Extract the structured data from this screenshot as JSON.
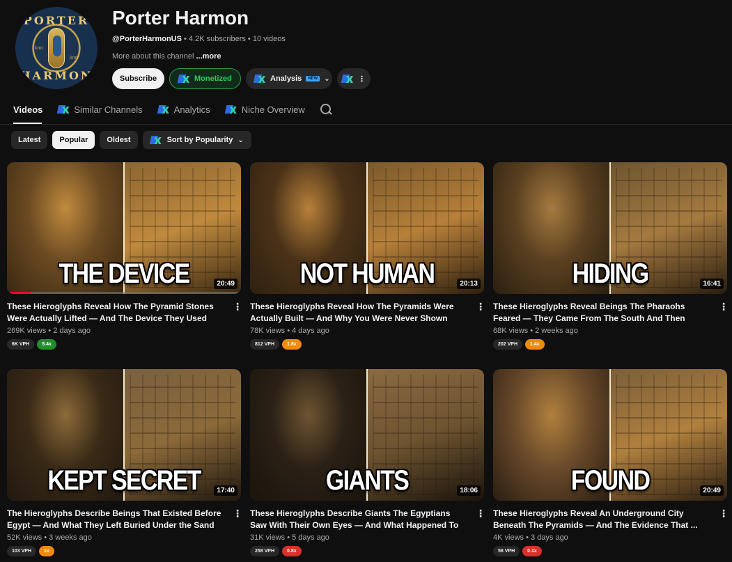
{
  "channel": {
    "name": "Porter Harmon",
    "handle": "@PorterHarmonUS",
    "meta_rest": " • 4.2K subscribers • 10 videos",
    "about": "More about this channel ",
    "about_more": "...more",
    "avatar_top": "PORTER",
    "avatar_bottom": "HARMON",
    "avatar_side_left": "kmt",
    "avatar_side_right": "kmt"
  },
  "buttons": {
    "subscribe": "Subscribe",
    "monetized": "Monetized",
    "analysis": "Analysis",
    "analysis_badge": "NEW",
    "more_dots": "⋮"
  },
  "tabs": [
    {
      "label": "Videos"
    },
    {
      "label": "Similar Channels"
    },
    {
      "label": "Analytics"
    },
    {
      "label": "Niche Overview"
    }
  ],
  "chips": {
    "latest": "Latest",
    "popular": "Popular",
    "oldest": "Oldest",
    "sort": "Sort by Popularity"
  },
  "colors": {
    "background": "#0f0f0f",
    "accent_green": "#2ecc5a",
    "badge_orange": "#f08a0c",
    "badge_red": "#d6312b"
  },
  "videos": [
    {
      "overlay": "THE DEVICE",
      "duration": "20:49",
      "title": "These Hieroglyphs Reveal How The Pyramid Stones Were Actually Lifted —  And The Device They Used",
      "stats": "269K views • 2 days ago",
      "vph": "6K VPH",
      "ratio": "5.4x",
      "ratio_color": "green",
      "watched": 0.1
    },
    {
      "overlay": "NOT HUMAN",
      "duration": "20:13",
      "title": "These Hieroglyphs Reveal How The Pyramids Were Actually Built — And Why You Were Never Shown Them",
      "stats": "78K views • 4 days ago",
      "vph": "812 VPH",
      "ratio": "1.8x",
      "ratio_color": "orange",
      "watched": 0
    },
    {
      "overlay": "HIDING",
      "duration": "16:41",
      "title": "These Hieroglyphs Reveal Beings The Pharaohs Feared — They Came From The South And Then Vanished",
      "stats": "68K views • 2 weeks ago",
      "vph": "202 VPH",
      "ratio": "1.4x",
      "ratio_color": "orange",
      "watched": 0
    },
    {
      "overlay": "KEPT SECRET",
      "duration": "17:40",
      "title": "The Hieroglyphs Describe Beings That Existed Before Egypt — And What They Left Buried Under the Sand",
      "stats": "52K views • 3 weeks ago",
      "vph": "103 VPH",
      "ratio": "1x",
      "ratio_color": "orange",
      "watched": 0
    },
    {
      "overlay": "GIANTS",
      "duration": "18:06",
      "title": "These Hieroglyphs Describe Giants The Egyptians Saw With Their Own Eyes — And What Happened To Them",
      "stats": "31K views • 5 days ago",
      "vph": "258 VPH",
      "ratio": "0.8x",
      "ratio_color": "red",
      "watched": 0
    },
    {
      "overlay": "FOUND",
      "duration": "20:49",
      "title": "These Hieroglyphs Reveal An Underground City Beneath The Pyramids — And The Evidence That ...",
      "stats": "4K views • 3 days ago",
      "vph": "58 VPH",
      "ratio": "0.1x",
      "ratio_color": "red",
      "watched": 0
    }
  ]
}
